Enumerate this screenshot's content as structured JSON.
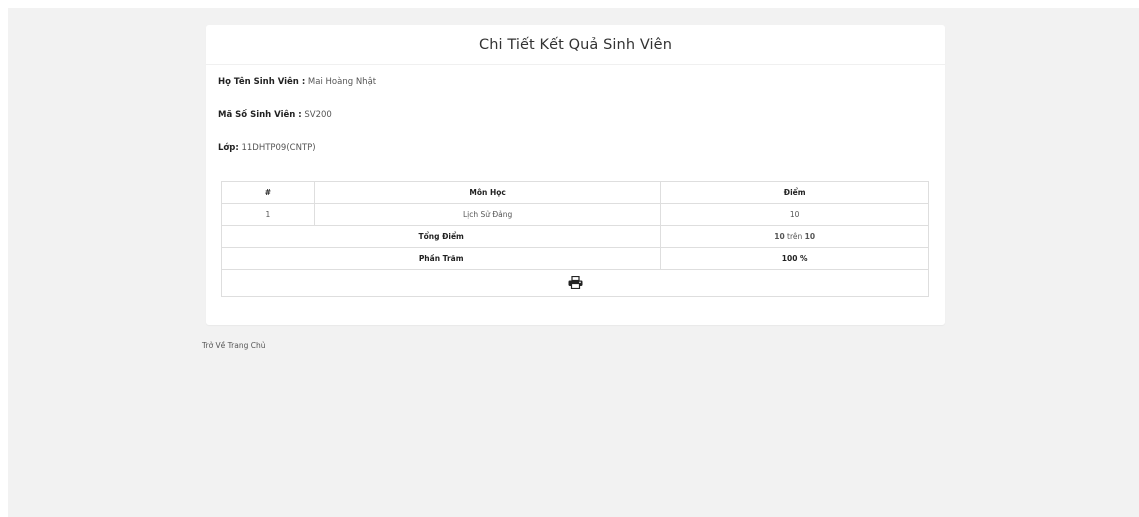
{
  "title": "Chi Tiết Kết Quả Sinh Viên",
  "student": {
    "name_label": "Họ Tên Sinh Viên :",
    "name_value": " Mai Hoàng Nhật",
    "id_label": "Mã Số Sinh Viên :",
    "id_value": " SV200",
    "class_label": "Lớp:",
    "class_value": " 11DHTP09(CNTP)"
  },
  "table": {
    "headers": [
      "#",
      "Môn Học",
      "Điểm"
    ],
    "rows": [
      {
        "index": "1",
        "subject": "Lịch Sử Đảng",
        "score": "10"
      }
    ],
    "total_label": "Tổng Điểm",
    "total_score": "10",
    "total_sep": " trên ",
    "total_max": "10",
    "percent_label": "Phần Trăm",
    "percent_value": "100 %"
  },
  "icons": {
    "print": "print-icon"
  },
  "footer": {
    "back_link": "Trở Về Trang Chủ"
  }
}
